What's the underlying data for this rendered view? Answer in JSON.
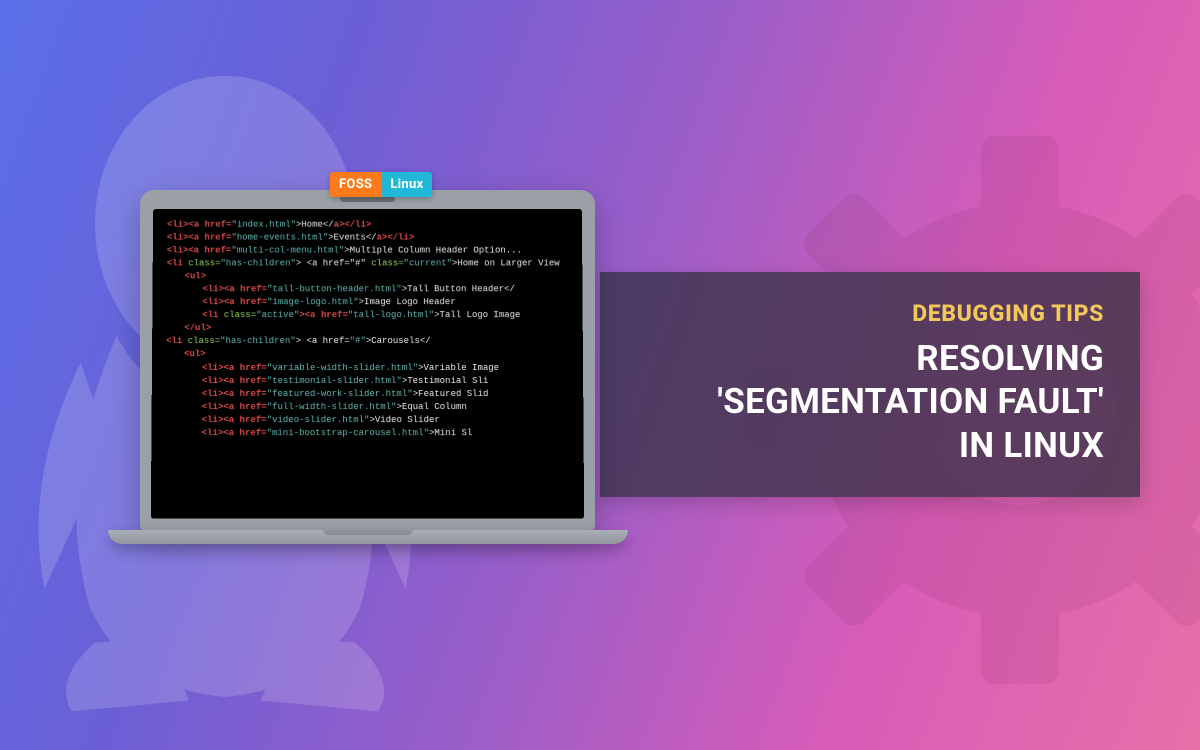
{
  "logo": {
    "left": "FOSS",
    "right": "Linux"
  },
  "panel": {
    "kicker": "DEBUGGING TIPS",
    "line1": "RESOLVING",
    "line2": "'SEGMENTATION FAULT'",
    "line3": "IN LINUX"
  },
  "code": {
    "l01a": "<li><a href=",
    "l01b": "\"index.html\"",
    "l01c": ">Home</",
    "l01d": "a></li>",
    "l02a": "<li><a href=",
    "l02b": "\"home-events.html\"",
    "l02c": ">Events</",
    "l02d": "a></li>",
    "l03a": "<li><a href=",
    "l03b": "\"multi-col-menu.html\"",
    "l03c": ">Multiple Column Header Option...",
    "l04a": "<li ",
    "l04b": "class=",
    "l04c": "\"has-children\"",
    "l04d": "> <a href=\"#\" ",
    "l04e": "class=",
    "l04f": "\"current\"",
    "l04g": ">Home on Larger View",
    "l05a": "<ul>",
    "l06a": "<li><a href=",
    "l06b": "\"tall-button-header.html\"",
    "l06c": ">Tall Button Header</",
    "l07a": "<li><a href=",
    "l07b": "\"image-logo.html\"",
    "l07c": ">Image Logo Header",
    "l08a": "<li ",
    "l08b": "class=",
    "l08c": "\"active\"",
    "l08d": "><a href=",
    "l08e": "\"tall-logo.html\"",
    "l08f": ">Tall Logo Image",
    "l09a": "</ul>",
    "l10a": "<li ",
    "l10b": "class=",
    "l10c": "\"has-children\"",
    "l10d": "> <a href=",
    "l10e": "\"#\"",
    "l10f": ">Carousels</",
    "l11a": "<ul>",
    "l12a": "<li><a href=",
    "l12b": "\"variable-width-slider.html\"",
    "l12c": ">Variable Image",
    "l13a": "<li><a href=",
    "l13b": "\"testimonial-slider.html\"",
    "l13c": ">Testimonial Sli",
    "l14a": "<li><a href=",
    "l14b": "\"featured-work-slider.html\"",
    "l14c": ">Featured Slid",
    "l15a": "<li><a href=",
    "l15b": "\"full-width-slider.html\"",
    "l15c": ">Equal Column",
    "l16a": "<li><a href=",
    "l16b": "\"video-slider.html\"",
    "l16c": ">Video Slider",
    "l17a": "<li><a href=",
    "l17b": "\"mini-bootstrap-carousel.html\"",
    "l17c": ">Mini Sl"
  },
  "colors": {
    "accent_yellow": "#f2c85b",
    "logo_orange": "#ff7a1a",
    "logo_cyan": "#20b8d6"
  }
}
